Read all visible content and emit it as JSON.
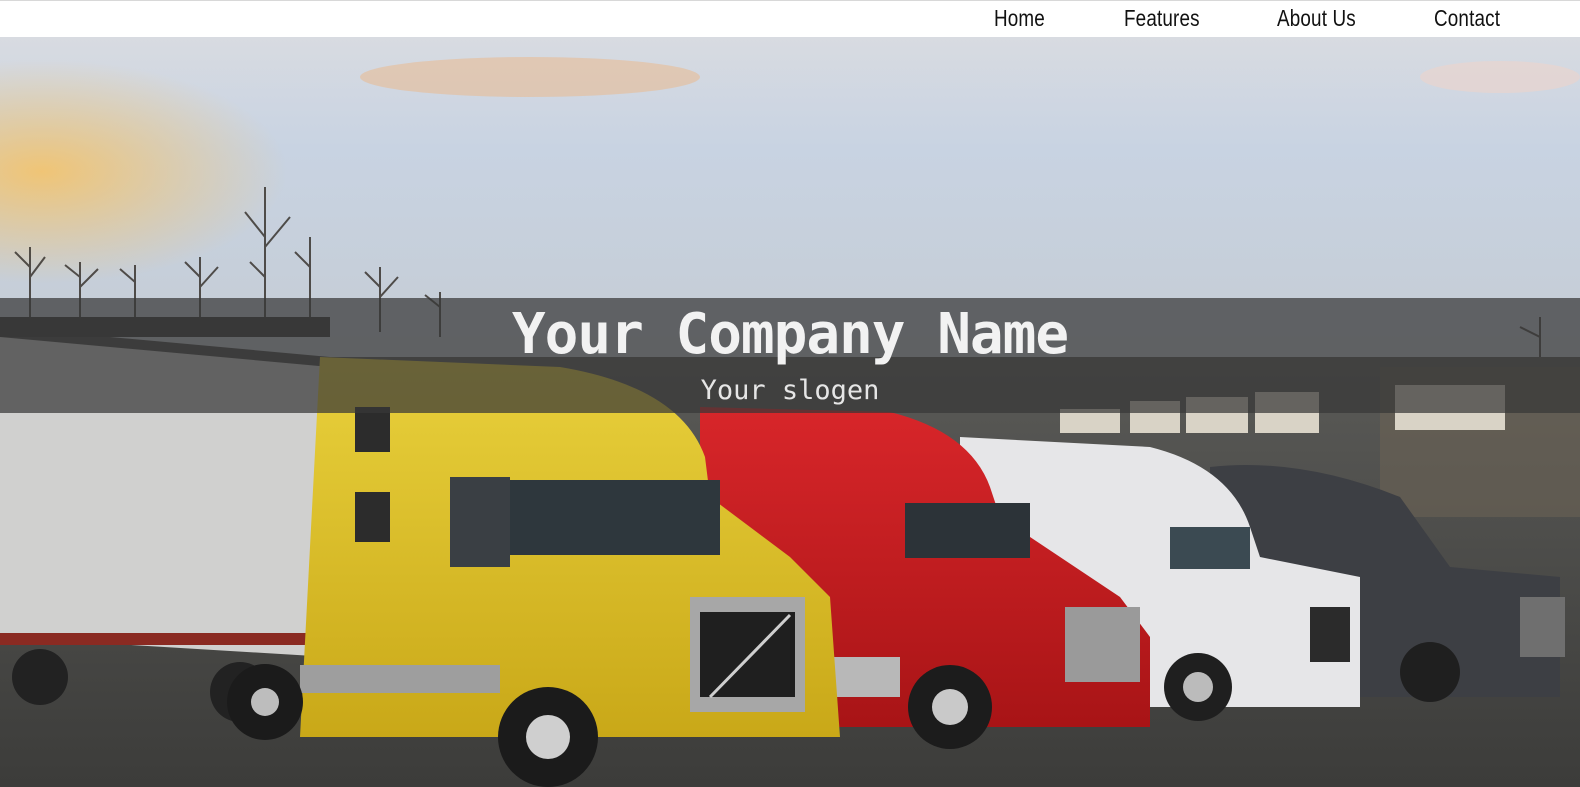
{
  "nav": {
    "items": [
      {
        "label": "Home"
      },
      {
        "label": "Features"
      },
      {
        "label": "About Us"
      },
      {
        "label": "Contact"
      }
    ]
  },
  "hero": {
    "title": "Your Company Name",
    "slogan": "Your slogen"
  },
  "colors": {
    "overlay": "#373737",
    "nav_bg": "#ffffff",
    "nav_text": "#111111"
  }
}
